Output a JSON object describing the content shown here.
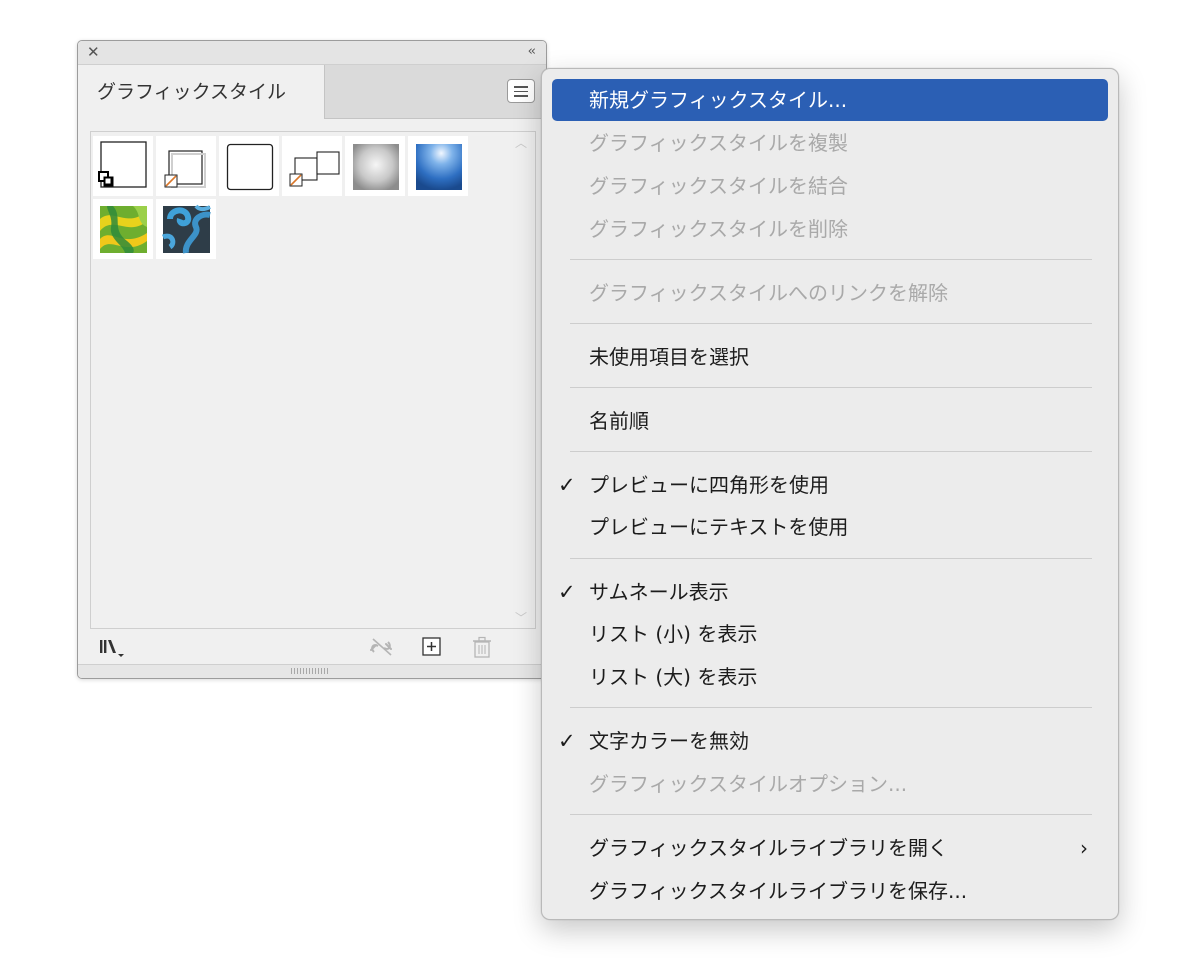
{
  "panel": {
    "close_icon": "close-icon",
    "collapse_glyph": "‹‹",
    "tab_label": "グラフィックスタイル",
    "menu_icon": "hamburger-menu-icon",
    "swatches": [
      {
        "name": "default-style",
        "kind": "outline-square"
      },
      {
        "name": "offset-square-style",
        "kind": "shadow-square"
      },
      {
        "name": "plain-square-style",
        "kind": "plain-square"
      },
      {
        "name": "double-square-style",
        "kind": "double-square"
      },
      {
        "name": "gray-bevel-style",
        "kind": "gray-gradient",
        "color": "#bdbdbd"
      },
      {
        "name": "blue-glow-style",
        "kind": "blue-gradient",
        "color": "#3b7fd0"
      },
      {
        "name": "green-swirl-style",
        "kind": "green-swirl",
        "color": "#8ac53f"
      },
      {
        "name": "blue-swirl-style",
        "kind": "blue-swirl",
        "color": "#3b8fc0"
      }
    ],
    "footer_icons": [
      "libraries-icon",
      "break-link-icon",
      "new-style-icon",
      "trash-icon"
    ]
  },
  "menu": {
    "items": [
      {
        "label": "新規グラフィックスタイル...",
        "state": "highlighted"
      },
      {
        "label": "グラフィックスタイルを複製",
        "state": "disabled"
      },
      {
        "label": "グラフィックスタイルを結合",
        "state": "disabled"
      },
      {
        "label": "グラフィックスタイルを削除",
        "state": "disabled"
      },
      {
        "label": "グラフィックスタイルへのリンクを解除",
        "state": "disabled"
      },
      {
        "label": "未使用項目を選択",
        "state": "enabled"
      },
      {
        "label": "名前順",
        "state": "enabled"
      },
      {
        "label": "プレビューに四角形を使用",
        "state": "enabled",
        "checked": true
      },
      {
        "label": "プレビューにテキストを使用",
        "state": "enabled"
      },
      {
        "label": "サムネール表示",
        "state": "enabled",
        "checked": true
      },
      {
        "label": "リスト (小) を表示",
        "state": "enabled"
      },
      {
        "label": "リスト (大) を表示",
        "state": "enabled"
      },
      {
        "label": "文字カラーを無効",
        "state": "enabled",
        "checked": true
      },
      {
        "label": "グラフィックスタイルオプション...",
        "state": "disabled"
      },
      {
        "label": "グラフィックスタイルライブラリを開く",
        "state": "enabled",
        "submenu": true
      },
      {
        "label": "グラフィックスタイルライブラリを保存...",
        "state": "enabled"
      }
    ],
    "check_glyph": "✓",
    "submenu_glyph": "›",
    "highlight_color": "#2b5fb4"
  }
}
